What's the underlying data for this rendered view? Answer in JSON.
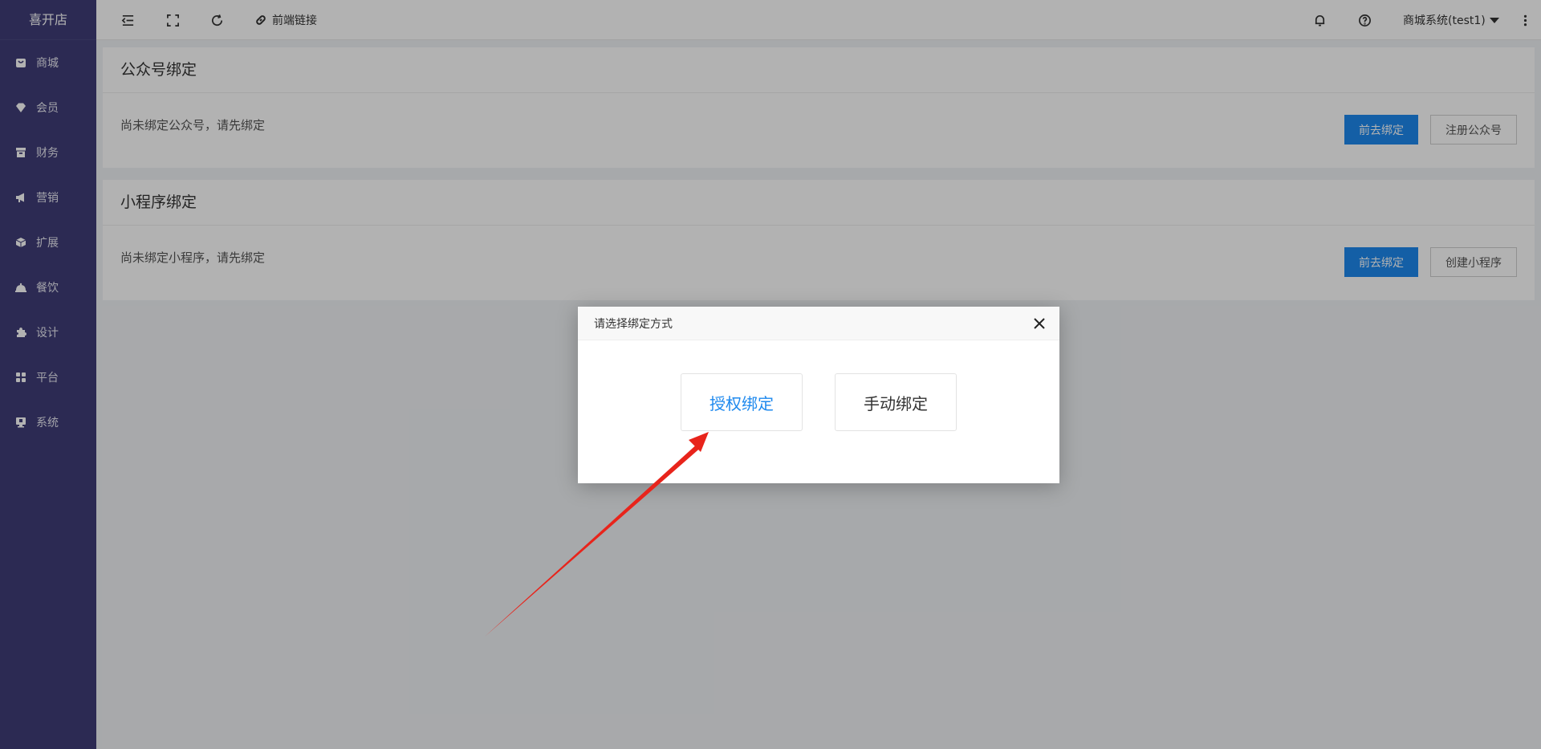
{
  "sidebar": {
    "brand": "喜开店",
    "items": [
      {
        "label": "商城",
        "icon": "shop-bag-icon"
      },
      {
        "label": "会员",
        "icon": "diamond-icon"
      },
      {
        "label": "财务",
        "icon": "finance-box-icon"
      },
      {
        "label": "营销",
        "icon": "megaphone-icon"
      },
      {
        "label": "扩展",
        "icon": "cube-icon"
      },
      {
        "label": "餐饮",
        "icon": "dish-cover-icon"
      },
      {
        "label": "设计",
        "icon": "puzzle-icon"
      },
      {
        "label": "平台",
        "icon": "grid-icon"
      },
      {
        "label": "系统",
        "icon": "monitor-icon"
      }
    ]
  },
  "topbar": {
    "link_label": "前端链接",
    "user_label": "商城系统(test1)"
  },
  "main": {
    "cards": [
      {
        "title": "公众号绑定",
        "message": "尚未绑定公众号，请先绑定",
        "primary_label": "前去绑定",
        "secondary_label": "注册公众号"
      },
      {
        "title": "小程序绑定",
        "message": "尚未绑定小程序，请先绑定",
        "primary_label": "前去绑定",
        "secondary_label": "创建小程序"
      }
    ]
  },
  "dialog": {
    "title": "请选择绑定方式",
    "options": [
      {
        "label": "授权绑定",
        "state": "highlighted"
      },
      {
        "label": "手动绑定",
        "state": "normal"
      }
    ]
  },
  "colors": {
    "sidebar_bg": "#3f3d77",
    "primary": "#1e89ee",
    "annotation_arrow": "#e8241b"
  }
}
